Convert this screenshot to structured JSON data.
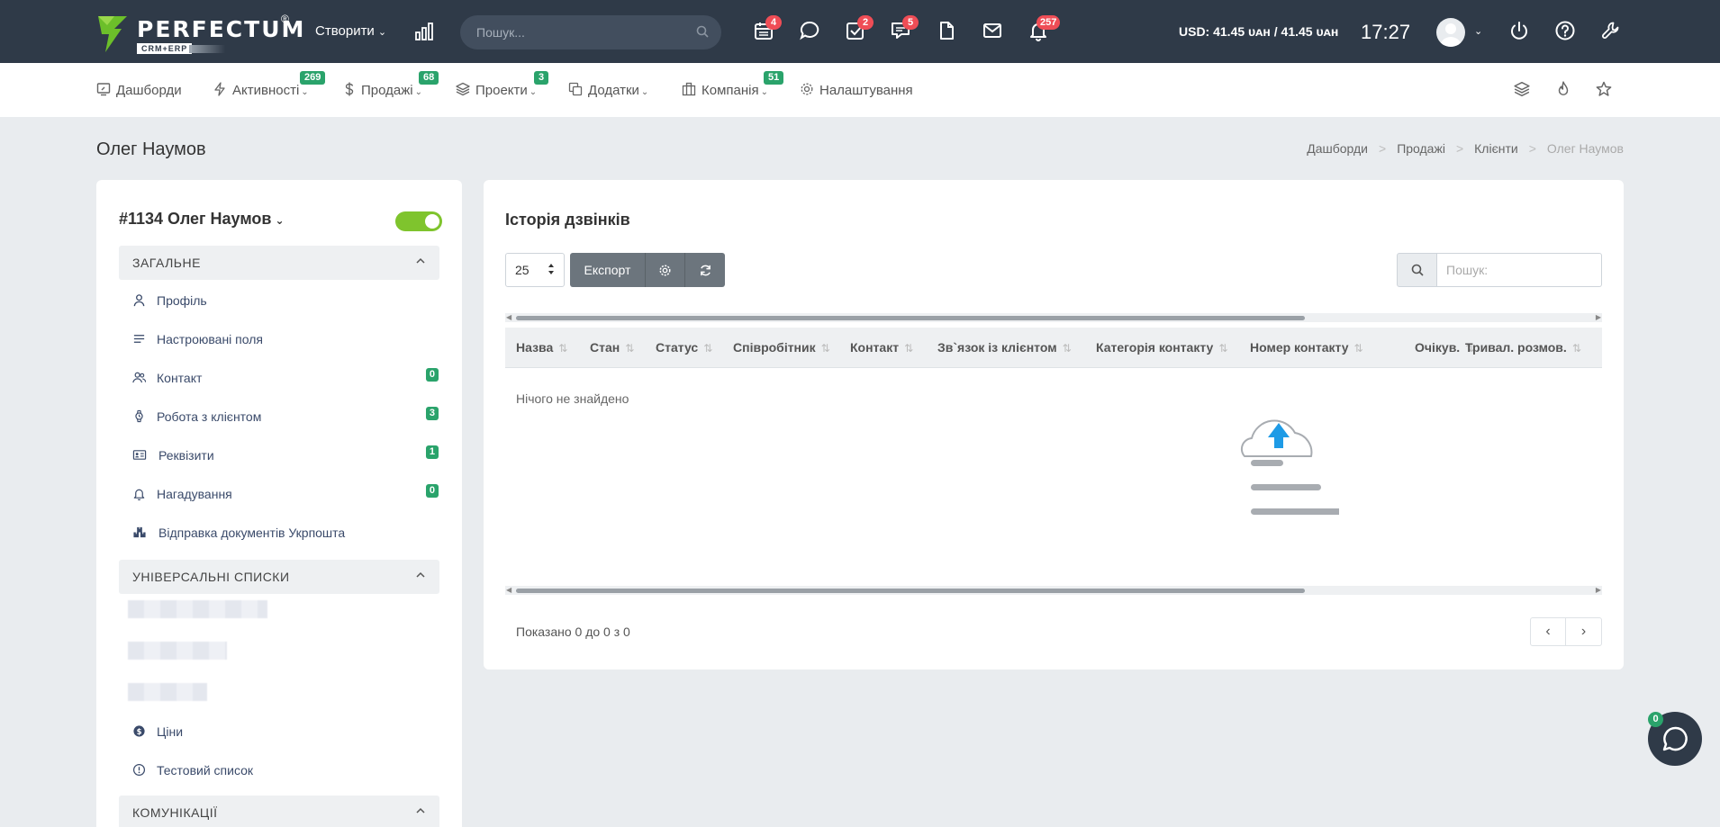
{
  "topbar": {
    "brand": "PERFECTUM",
    "brand_reg": "®",
    "brand_sub": "CRM+ERP",
    "create_label": "Створити",
    "search_placeholder": "Пошук...",
    "icons": [
      {
        "name": "calendar-icon",
        "badge": "4"
      },
      {
        "name": "chat-bubble-icon",
        "badge": ""
      },
      {
        "name": "tasks-check-icon",
        "badge": "2"
      },
      {
        "name": "messages-icon",
        "badge": "5"
      },
      {
        "name": "document-icon",
        "badge": ""
      },
      {
        "name": "mail-icon",
        "badge": ""
      },
      {
        "name": "bell-icon",
        "badge": "257"
      }
    ],
    "currency": "USD: 41.45 ᴜᴀʜ / 41.45 ᴜᴀʜ",
    "time": "17:27"
  },
  "nav": {
    "items": [
      {
        "label": "Дашборди",
        "badge": ""
      },
      {
        "label": "Активності",
        "badge": "269"
      },
      {
        "label": "Продажі",
        "badge": "68"
      },
      {
        "label": "Проекти",
        "badge": "3"
      },
      {
        "label": "Додатки",
        "badge": ""
      },
      {
        "label": "Компанія",
        "badge": "51"
      },
      {
        "label": "Налаштування",
        "badge": ""
      }
    ]
  },
  "page": {
    "title": "Олег Наумов",
    "breadcrumb": [
      "Дашборди",
      "Продажі",
      "Клієнти",
      "Олег Наумов"
    ]
  },
  "client": {
    "name": "#1134 Олег Наумов",
    "active": true
  },
  "sidebar": {
    "sections": [
      {
        "title": "ЗАГАЛЬНЕ",
        "items": [
          {
            "label": "Профіль",
            "count": ""
          },
          {
            "label": "Настроювані поля",
            "count": ""
          },
          {
            "label": "Контакт",
            "count": "0"
          },
          {
            "label": "Робота з клієнтом",
            "count": "3"
          },
          {
            "label": "Реквізити",
            "count": "1"
          },
          {
            "label": "Нагадування",
            "count": "0"
          },
          {
            "label": "Відправка документів Укрпошта",
            "count": ""
          }
        ]
      },
      {
        "title": "УНІВЕРСАЛЬНІ СПИСКИ",
        "items": [
          {
            "label": "Ціни",
            "count": ""
          },
          {
            "label": "Тестовий список",
            "count": ""
          }
        ]
      },
      {
        "title": "КОМУНІКАЦІЇ",
        "items": []
      }
    ]
  },
  "calls": {
    "title": "Історія дзвінків",
    "page_length": "25",
    "export_label": "Експорт",
    "search_placeholder": "Пошук:",
    "columns": [
      "Назва",
      "Стан",
      "Статус",
      "Співробітник",
      "Контакт",
      "Зв`язок із клієнтом",
      "Категорія контакту",
      "Номер контакту",
      "Очікув.",
      "Тривал. розмов."
    ],
    "empty_text": "Нічого не знайдено",
    "info": "Показано 0 до 0 з 0"
  },
  "chat_widget": {
    "badge": "0"
  },
  "colors": {
    "topbar": "#2f3a48",
    "accent_green": "#2aa36b",
    "badge_red": "#ef4d56",
    "toggle_on": "#7fc42d",
    "upload_blue": "#1e9be6"
  }
}
